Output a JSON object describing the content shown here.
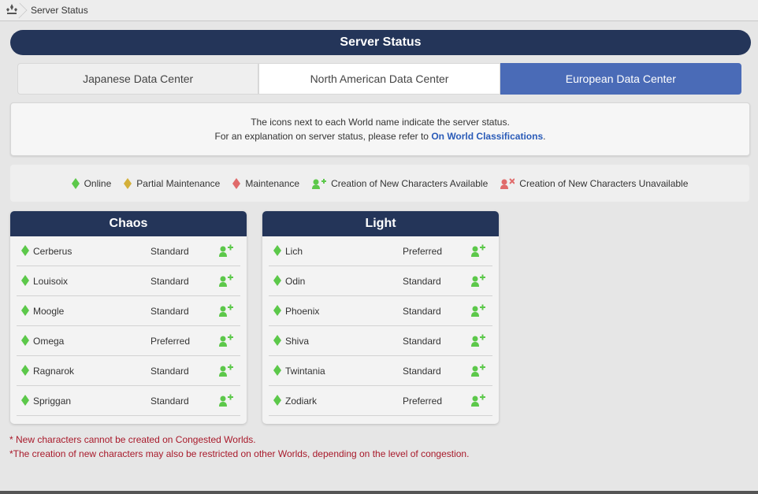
{
  "breadcrumb": {
    "current": "Server Status"
  },
  "page_title": "Server Status",
  "tabs": [
    {
      "label": "Japanese Data Center",
      "active": false
    },
    {
      "label": "North American Data Center",
      "active": false
    },
    {
      "label": "European Data Center",
      "active": true
    }
  ],
  "info": {
    "line1": "The icons next to each World name indicate the server status.",
    "line2_prefix": "For an explanation on server status, please refer to ",
    "line2_link": "On World Classifications",
    "line2_suffix": "."
  },
  "legend": {
    "online": "Online",
    "partial": "Partial Maintenance",
    "maintenance": "Maintenance",
    "creation_available": "Creation of New Characters Available",
    "creation_unavailable": "Creation of New Characters Unavailable"
  },
  "colors": {
    "online": "#5cc84a",
    "partial": "#d4b03a",
    "maintenance": "#e06a6a",
    "navy": "#243559",
    "active_tab": "#4a6bb7",
    "link": "#2a5bb8",
    "note": "#a8192a"
  },
  "data_centers": [
    {
      "name": "Chaos",
      "worlds": [
        {
          "name": "Cerberus",
          "category": "Standard",
          "status": "online",
          "creation": "available"
        },
        {
          "name": "Louisoix",
          "category": "Standard",
          "status": "online",
          "creation": "available"
        },
        {
          "name": "Moogle",
          "category": "Standard",
          "status": "online",
          "creation": "available"
        },
        {
          "name": "Omega",
          "category": "Preferred",
          "status": "online",
          "creation": "available"
        },
        {
          "name": "Ragnarok",
          "category": "Standard",
          "status": "online",
          "creation": "available"
        },
        {
          "name": "Spriggan",
          "category": "Standard",
          "status": "online",
          "creation": "available"
        }
      ]
    },
    {
      "name": "Light",
      "worlds": [
        {
          "name": "Lich",
          "category": "Preferred",
          "status": "online",
          "creation": "available"
        },
        {
          "name": "Odin",
          "category": "Standard",
          "status": "online",
          "creation": "available"
        },
        {
          "name": "Phoenix",
          "category": "Standard",
          "status": "online",
          "creation": "available"
        },
        {
          "name": "Shiva",
          "category": "Standard",
          "status": "online",
          "creation": "available"
        },
        {
          "name": "Twintania",
          "category": "Standard",
          "status": "online",
          "creation": "available"
        },
        {
          "name": "Zodiark",
          "category": "Preferred",
          "status": "online",
          "creation": "available"
        }
      ]
    }
  ],
  "notes": [
    "* New characters cannot be created on Congested Worlds.",
    "*The creation of new characters may also be restricted on other Worlds, depending on the level of congestion."
  ]
}
